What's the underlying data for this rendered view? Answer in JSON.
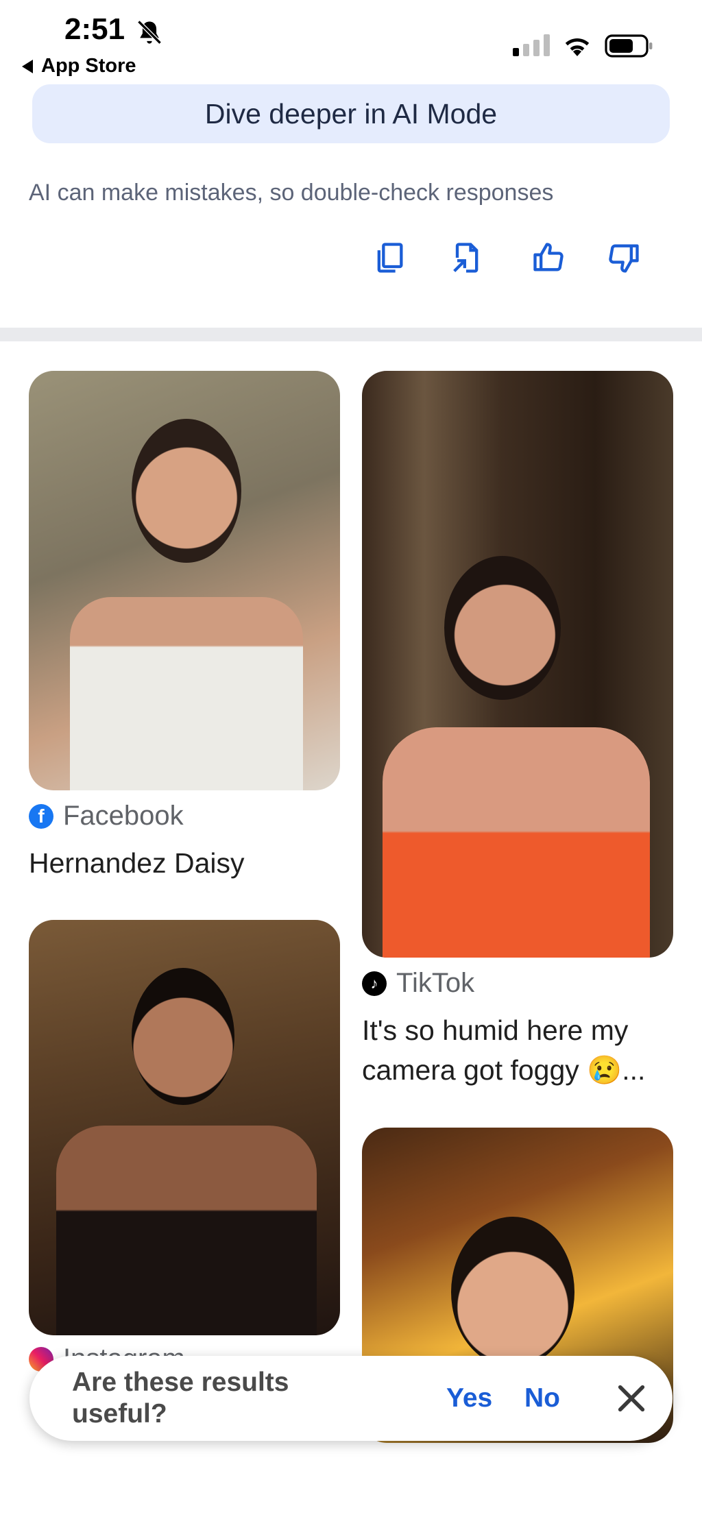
{
  "status_bar": {
    "time": "2:51",
    "back_label": "App Store"
  },
  "ai_mode": {
    "button_label": "Dive deeper in AI Mode",
    "disclaimer": "AI can make mistakes, so double-check responses"
  },
  "actions": [
    "copy-icon",
    "share-icon",
    "thumbs-up-icon",
    "thumbs-down-icon"
  ],
  "results": [
    {
      "source": "Facebook",
      "title": "Hernandez Daisy"
    },
    {
      "source": "TikTok",
      "title_line1": "It's so humid here my",
      "title_line2": "camera got foggy 😢..."
    },
    {
      "source": "Instagram"
    },
    {
      "source": ""
    }
  ],
  "feedback": {
    "question": "Are these results useful?",
    "yes": "Yes",
    "no": "No"
  },
  "colors": {
    "accent": "#1a5dd6",
    "ai_button_bg": "#e5ecfd",
    "facebook": "#1877f2"
  }
}
